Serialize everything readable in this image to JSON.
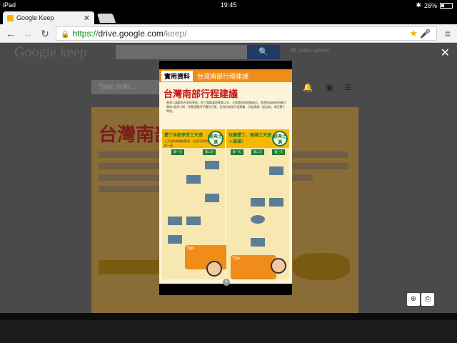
{
  "status_bar": {
    "device": "iPad",
    "time": "19:45",
    "battery": "26%",
    "battery_level": 0.26
  },
  "tabs": [
    {
      "title": "Google Keep"
    }
  ],
  "omnibox": {
    "scheme": "https://",
    "host": "drive.google.com",
    "path": "/keep/"
  },
  "background_app": {
    "logo": "Google keep",
    "search_button": "🔍",
    "saved_text": "All notes saved",
    "note_placeholder": "Type note...",
    "doc_heading": "台灣南部"
  },
  "viewer": {
    "page_number": "4",
    "header_label": "實用資料",
    "header_section": "台灣南部行程建議",
    "title": "台灣南部行程建議",
    "intro": "香港人喜歡到台灣的原因，除了喜歡當地美食以外，主要還因為地點較近。香港與高雄來飛機只需約1個多小時，免簽證費用手續也方便。台灣的南部行程建議，可從高雄一起出發，來回墾丁等地。",
    "columns": [
      {
        "title": "墾丁休閒享受三天遊",
        "subtitle": "三天遊的時間較緊湊，但也可欣賞到墾丁美麗的一面",
        "badge": "經典之選",
        "days": [
          "第一天",
          "第二天"
        ]
      },
      {
        "title": "玩盡墾丁、高雄三天遊（墾丁＋高雄）",
        "subtitle": "",
        "badge": "經典之選",
        "days": [
          "第一天",
          "第二天",
          "第三天"
        ]
      }
    ],
    "tip_label": "Tips"
  },
  "controls": {
    "close": "✕",
    "zoom": "⊕",
    "print": "⎙"
  },
  "colors": {
    "accent_orange": "#f08c1a",
    "header_green": "#1d7a31",
    "title_red": "#c2181d"
  }
}
